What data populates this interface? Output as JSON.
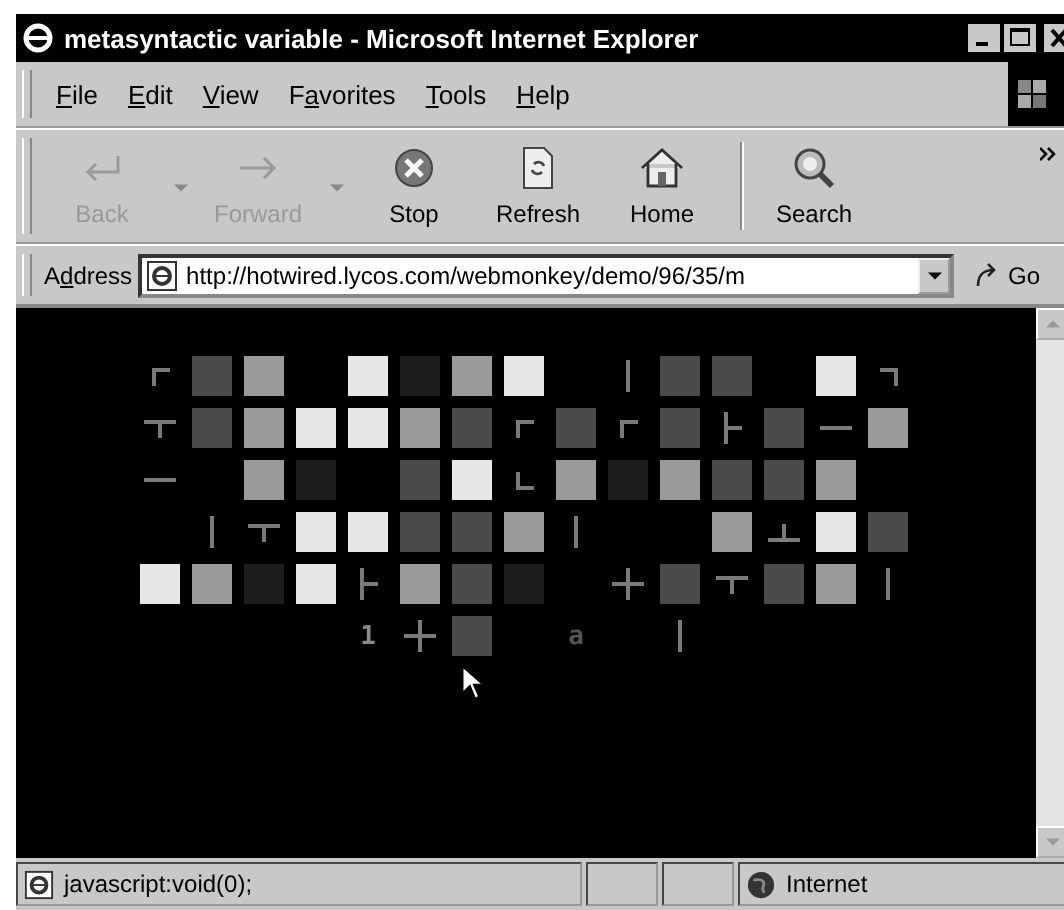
{
  "window": {
    "title": "metasyntactic variable - Microsoft Internet Explorer"
  },
  "menu": [
    {
      "key": "F",
      "post": "ile"
    },
    {
      "key": "E",
      "post": "dit"
    },
    {
      "key": "V",
      "post": "iew"
    },
    {
      "pre": "F",
      "key": "a",
      "post": "vorites"
    },
    {
      "key": "T",
      "post": "ools"
    },
    {
      "key": "H",
      "post": "elp"
    }
  ],
  "toolbar": [
    {
      "label": "Back",
      "kind": "back",
      "disabled": true,
      "dropdown": true
    },
    {
      "label": "Forward",
      "kind": "forward",
      "disabled": true,
      "dropdown": true
    },
    {
      "label": "Stop",
      "kind": "stop",
      "disabled": false,
      "dropdown": false
    },
    {
      "label": "Refresh",
      "kind": "refresh",
      "disabled": false,
      "dropdown": false
    },
    {
      "label": "Home",
      "kind": "home",
      "disabled": false,
      "dropdown": false
    },
    {
      "label": "Search",
      "kind": "search",
      "disabled": false,
      "dropdown": false
    }
  ],
  "address": {
    "label": {
      "pre": "A",
      "key": "d",
      "post": "dress"
    },
    "url": "http://hotwired.lycos.com/webmonkey/demo/96/35/m",
    "go": "Go"
  },
  "grid": [
    [
      {
        "kind": "topleft"
      },
      {
        "kind": "square",
        "color": "#4a4a4a"
      },
      {
        "kind": "square",
        "color": "#9a9a9a"
      },
      {
        "kind": "empty"
      },
      {
        "kind": "square",
        "color": "#e6e6e6"
      },
      {
        "kind": "square",
        "color": "#1c1c1c"
      },
      {
        "kind": "square",
        "color": "#9a9a9a"
      },
      {
        "kind": "square",
        "color": "#e6e6e6"
      },
      {
        "kind": "empty"
      },
      {
        "kind": "bar"
      },
      {
        "kind": "square",
        "color": "#4a4a4a"
      },
      {
        "kind": "square",
        "color": "#4a4a4a"
      },
      {
        "kind": "empty"
      },
      {
        "kind": "square",
        "color": "#e6e6e6"
      },
      {
        "kind": "topright"
      }
    ],
    [
      {
        "kind": "teedown"
      },
      {
        "kind": "square",
        "color": "#4a4a4a"
      },
      {
        "kind": "square",
        "color": "#9a9a9a"
      },
      {
        "kind": "square",
        "color": "#e6e6e6"
      },
      {
        "kind": "square",
        "color": "#e6e6e6"
      },
      {
        "kind": "square",
        "color": "#9a9a9a"
      },
      {
        "kind": "square",
        "color": "#4a4a4a"
      },
      {
        "kind": "topleft"
      },
      {
        "kind": "square",
        "color": "#4a4a4a"
      },
      {
        "kind": "topleft"
      },
      {
        "kind": "square",
        "color": "#4a4a4a"
      },
      {
        "kind": "teeright"
      },
      {
        "kind": "square",
        "color": "#4a4a4a"
      },
      {
        "kind": "dash"
      },
      {
        "kind": "square",
        "color": "#9a9a9a"
      }
    ],
    [
      {
        "kind": "dash"
      },
      {
        "kind": "empty"
      },
      {
        "kind": "square",
        "color": "#9a9a9a"
      },
      {
        "kind": "square",
        "color": "#1c1c1c"
      },
      {
        "kind": "empty"
      },
      {
        "kind": "square",
        "color": "#4a4a4a"
      },
      {
        "kind": "square",
        "color": "#e6e6e6"
      },
      {
        "kind": "bottomleft"
      },
      {
        "kind": "square",
        "color": "#9a9a9a"
      },
      {
        "kind": "square",
        "color": "#1c1c1c"
      },
      {
        "kind": "square",
        "color": "#9a9a9a"
      },
      {
        "kind": "square",
        "color": "#4a4a4a"
      },
      {
        "kind": "square",
        "color": "#4a4a4a"
      },
      {
        "kind": "square",
        "color": "#9a9a9a"
      },
      {
        "kind": "empty"
      }
    ],
    [
      {
        "kind": "empty"
      },
      {
        "kind": "bar"
      },
      {
        "kind": "teedown"
      },
      {
        "kind": "square",
        "color": "#e6e6e6"
      },
      {
        "kind": "square",
        "color": "#e6e6e6"
      },
      {
        "kind": "square",
        "color": "#4a4a4a"
      },
      {
        "kind": "square",
        "color": "#4a4a4a"
      },
      {
        "kind": "square",
        "color": "#9a9a9a"
      },
      {
        "kind": "bar"
      },
      {
        "kind": "empty"
      },
      {
        "kind": "empty"
      },
      {
        "kind": "square",
        "color": "#9a9a9a"
      },
      {
        "kind": "teeup"
      },
      {
        "kind": "square",
        "color": "#e6e6e6"
      },
      {
        "kind": "square",
        "color": "#4a4a4a"
      }
    ],
    [
      {
        "kind": "square",
        "color": "#e6e6e6"
      },
      {
        "kind": "square",
        "color": "#9a9a9a"
      },
      {
        "kind": "square",
        "color": "#1c1c1c"
      },
      {
        "kind": "square",
        "color": "#e6e6e6"
      },
      {
        "kind": "teeright"
      },
      {
        "kind": "square",
        "color": "#9a9a9a"
      },
      {
        "kind": "square",
        "color": "#4a4a4a"
      },
      {
        "kind": "square",
        "color": "#1c1c1c"
      },
      {
        "kind": "empty"
      },
      {
        "kind": "cross"
      },
      {
        "kind": "square",
        "color": "#4a4a4a"
      },
      {
        "kind": "teedown"
      },
      {
        "kind": "square",
        "color": "#4a4a4a"
      },
      {
        "kind": "square",
        "color": "#9a9a9a"
      },
      {
        "kind": "bar"
      }
    ],
    [
      {
        "kind": "empty"
      },
      {
        "kind": "empty"
      },
      {
        "kind": "empty"
      },
      {
        "kind": "empty"
      },
      {
        "kind": "char",
        "text": "1",
        "color": "#8a8a8a"
      },
      {
        "kind": "cross"
      },
      {
        "kind": "square",
        "color": "#4a4a4a"
      },
      {
        "kind": "empty"
      },
      {
        "kind": "char",
        "text": "a",
        "color": "#555555"
      },
      {
        "kind": "empty"
      },
      {
        "kind": "bar"
      }
    ]
  ],
  "status_bar": {
    "text": "javascript:void(0);",
    "zone": "Internet"
  }
}
